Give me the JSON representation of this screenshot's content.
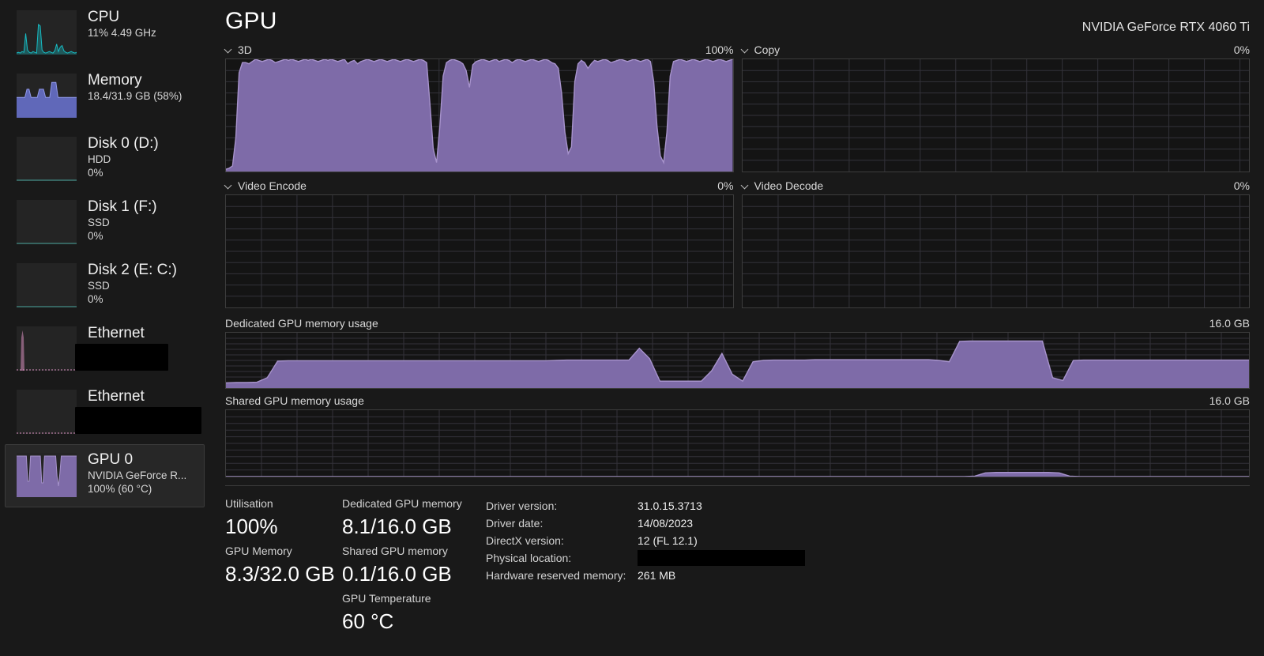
{
  "colors": {
    "accent_purple": "#7e6ba8",
    "accent_purple_line": "#a793cc",
    "cpu_cyan": "#17bcc4",
    "memory_blue": "#6b74d4",
    "ethernet_pink": "#d98fc0",
    "background": "#191919",
    "chart_bg": "#141414",
    "grid": "#33323a"
  },
  "sidebar": {
    "items": [
      {
        "name": "cpu",
        "title": "CPU",
        "sub1": "11%  4.49 GHz",
        "sub2": "",
        "selected": false,
        "redacted": false,
        "graph": "cpu"
      },
      {
        "name": "memory",
        "title": "Memory",
        "sub1": "18.4/31.9 GB (58%)",
        "sub2": "",
        "selected": false,
        "redacted": false,
        "graph": "memory"
      },
      {
        "name": "disk-0",
        "title": "Disk 0 (D:)",
        "sub1": "HDD",
        "sub2": "0%",
        "selected": false,
        "redacted": false,
        "graph": "flat-teal"
      },
      {
        "name": "disk-1",
        "title": "Disk 1 (F:)",
        "sub1": "SSD",
        "sub2": "0%",
        "selected": false,
        "redacted": false,
        "graph": "flat-teal"
      },
      {
        "name": "disk-2",
        "title": "Disk 2 (E: C:)",
        "sub1": "SSD",
        "sub2": "0%",
        "selected": false,
        "redacted": false,
        "graph": "flat-teal"
      },
      {
        "name": "ethernet-1",
        "title": "Ethernet",
        "sub1": "",
        "sub2": "",
        "selected": false,
        "redacted": true,
        "graph": "ethernet-spike"
      },
      {
        "name": "ethernet-2",
        "title": "Ethernet",
        "sub1": "",
        "sub2": "",
        "selected": false,
        "redacted": true,
        "graph": "ethernet-flat"
      },
      {
        "name": "gpu-0",
        "title": "GPU 0",
        "sub1": "NVIDIA GeForce R...",
        "sub2": "100%  (60 °C)",
        "selected": true,
        "redacted": false,
        "graph": "gpu"
      }
    ]
  },
  "header": {
    "title": "GPU",
    "device": "NVIDIA GeForce RTX 4060 Ti"
  },
  "charts": {
    "engine_3d": {
      "label": "3D",
      "max": "100%",
      "has_chevron": true
    },
    "copy": {
      "label": "Copy",
      "max": "0%",
      "has_chevron": true
    },
    "video_encode": {
      "label": "Video Encode",
      "max": "0%",
      "has_chevron": true
    },
    "video_decode": {
      "label": "Video Decode",
      "max": "0%",
      "has_chevron": true
    },
    "dedicated_mem": {
      "label": "Dedicated GPU memory usage",
      "max": "16.0 GB",
      "has_chevron": false
    },
    "shared_mem": {
      "label": "Shared GPU memory usage",
      "max": "16.0 GB",
      "has_chevron": false
    }
  },
  "chart_data": [
    {
      "type": "area",
      "name": "3D",
      "title": "3D",
      "ylabel": "",
      "ylim": [
        0,
        100
      ],
      "unit": "%",
      "values": [
        2,
        3,
        5,
        30,
        88,
        97,
        97,
        96,
        98,
        100,
        99,
        98,
        99,
        100,
        99,
        97,
        98,
        99,
        100,
        99,
        100,
        99,
        98,
        99,
        100,
        99,
        100,
        99,
        98,
        99,
        100,
        99,
        100,
        99,
        98,
        99,
        100,
        96,
        98,
        99,
        96,
        98,
        99,
        100,
        99,
        98,
        99,
        100,
        99,
        98,
        99,
        100,
        99,
        98,
        99,
        100,
        99,
        98,
        99,
        100,
        99,
        97,
        60,
        20,
        8,
        40,
        85,
        97,
        99,
        100,
        99,
        98,
        96,
        90,
        75,
        95,
        98,
        99,
        100,
        99,
        98,
        99,
        100,
        98,
        99,
        100,
        99,
        97,
        99,
        100,
        99,
        98,
        99,
        100,
        99,
        98,
        99,
        100,
        99,
        97,
        96,
        92,
        70,
        35,
        16,
        22,
        80,
        96,
        99,
        97,
        92,
        96,
        99,
        98,
        99,
        100,
        99,
        97,
        98,
        99,
        100,
        99,
        98,
        99,
        100,
        99,
        98,
        99,
        100,
        98,
        80,
        40,
        14,
        8,
        35,
        85,
        98,
        99,
        100,
        99,
        98,
        99,
        100,
        99,
        98,
        99,
        100,
        99,
        98,
        99,
        100,
        99,
        98,
        99,
        100
      ]
    },
    {
      "type": "area",
      "name": "Copy",
      "title": "Copy",
      "ylim": [
        0,
        100
      ],
      "unit": "%",
      "values": [
        0,
        0,
        0,
        0,
        0,
        0,
        0,
        0,
        0,
        0,
        0,
        0,
        0,
        0,
        0,
        0,
        0,
        0,
        0,
        0
      ]
    },
    {
      "type": "area",
      "name": "Video Encode",
      "title": "Video Encode",
      "ylim": [
        0,
        100
      ],
      "unit": "%",
      "values": [
        0,
        0,
        0,
        0,
        0,
        0,
        0,
        0,
        0,
        0,
        0,
        0,
        0,
        0,
        0,
        0,
        0,
        0,
        0,
        0
      ]
    },
    {
      "type": "area",
      "name": "Video Decode",
      "title": "Video Decode",
      "ylim": [
        0,
        100
      ],
      "unit": "%",
      "values": [
        0,
        0,
        0,
        0,
        0,
        0,
        0,
        0,
        0,
        0,
        0,
        0,
        0,
        0,
        0,
        0,
        0,
        0,
        0,
        0
      ]
    },
    {
      "type": "area",
      "name": "Dedicated GPU memory usage",
      "title": "Dedicated GPU memory usage",
      "ylim": [
        0,
        16
      ],
      "unit": "GB",
      "values": [
        1.5,
        1.6,
        1.6,
        1.7,
        3.0,
        7.8,
        7.9,
        7.9,
        7.9,
        7.9,
        7.9,
        7.9,
        7.9,
        7.9,
        7.9,
        7.9,
        7.9,
        7.9,
        7.9,
        7.9,
        7.9,
        7.9,
        7.9,
        7.9,
        7.9,
        7.9,
        7.9,
        7.9,
        7.9,
        7.9,
        7.9,
        7.9,
        8.0,
        8.1,
        8.1,
        8.1,
        8.1,
        8.1,
        8.1,
        8.1,
        11.5,
        8.5,
        2.0,
        2.0,
        2.0,
        2.0,
        2.0,
        5.0,
        10.0,
        4.0,
        2.0,
        7.6,
        8.0,
        8.1,
        8.1,
        8.1,
        8.1,
        8.2,
        8.2,
        8.2,
        8.2,
        8.2,
        8.2,
        8.2,
        8.2,
        8.2,
        8.2,
        8.2,
        8.2,
        8.0,
        7.6,
        13.5,
        13.6,
        13.6,
        13.6,
        13.6,
        13.6,
        13.6,
        13.6,
        13.6,
        3.0,
        2.2,
        8.0,
        8.1,
        8.1,
        8.1,
        8.1,
        8.1,
        8.1,
        8.1,
        8.1,
        8.1,
        8.1,
        8.1,
        8.1,
        8.1,
        8.1,
        8.1,
        8.1,
        8.1
      ]
    },
    {
      "type": "area",
      "name": "Shared GPU memory usage",
      "title": "Shared GPU memory usage",
      "ylim": [
        0,
        16
      ],
      "unit": "GB",
      "values": [
        0,
        0,
        0,
        0,
        0,
        0,
        0,
        0,
        0,
        0,
        0,
        0,
        0,
        0,
        0,
        0,
        0,
        0,
        0,
        0,
        0,
        0,
        0,
        0,
        0,
        0,
        0,
        0,
        0,
        0,
        0,
        0,
        0,
        0,
        0,
        0,
        0,
        0,
        0,
        0,
        0,
        0,
        0,
        0,
        0,
        0,
        0,
        0,
        0,
        0,
        0,
        0,
        0,
        0,
        0,
        0,
        0,
        0,
        0,
        0,
        0,
        0,
        0,
        0,
        0,
        0,
        0,
        0,
        0,
        0,
        0,
        0.1,
        0.9,
        1.0,
        1.0,
        1.0,
        1.0,
        1.0,
        1.0,
        0.9,
        0.1,
        0,
        0,
        0,
        0,
        0,
        0,
        0,
        0,
        0,
        0,
        0,
        0,
        0,
        0,
        0,
        0,
        0
      ]
    }
  ],
  "stats": {
    "utilisation": {
      "label": "Utilisation",
      "value": "100%"
    },
    "gpu_memory": {
      "label": "GPU Memory",
      "value": "8.3/32.0 GB"
    },
    "dedicated_gpu_memory": {
      "label": "Dedicated GPU memory",
      "value": "8.1/16.0 GB"
    },
    "shared_gpu_memory": {
      "label": "Shared GPU memory",
      "value": "0.1/16.0 GB"
    },
    "gpu_temperature": {
      "label": "GPU Temperature",
      "value": "60 °C"
    }
  },
  "driver_info": {
    "driver_version": {
      "label": "Driver version:",
      "value": "31.0.15.3713"
    },
    "driver_date": {
      "label": "Driver date:",
      "value": "14/08/2023"
    },
    "directx_version": {
      "label": "DirectX version:",
      "value": "12 (FL 12.1)"
    },
    "physical_location": {
      "label": "Physical location:",
      "value": ""
    },
    "hardware_reserved_memory": {
      "label": "Hardware reserved memory:",
      "value": "261 MB"
    }
  }
}
